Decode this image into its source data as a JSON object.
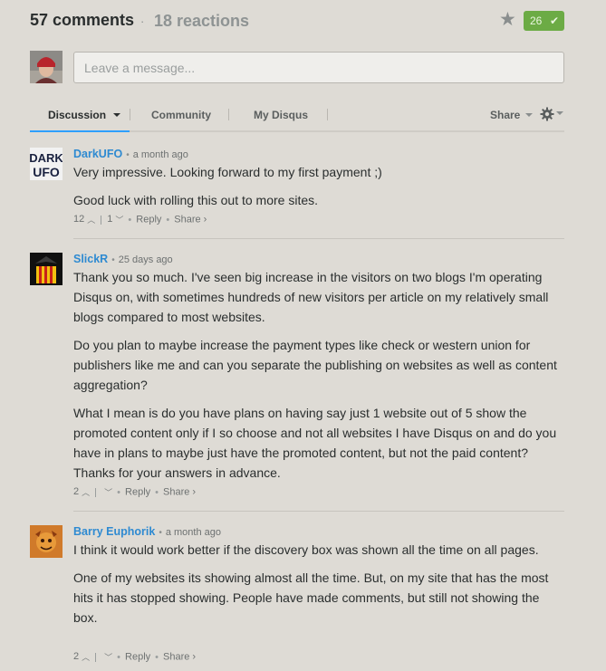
{
  "header": {
    "comments_count": "57 comments",
    "separator": "·",
    "reactions_count": "18 reactions",
    "favorite_count": "26",
    "accent_color": "#6cab45",
    "link_color": "#2e8ad1"
  },
  "composer": {
    "placeholder": "Leave a message..."
  },
  "nav": {
    "tabs": [
      {
        "label": "Discussion"
      },
      {
        "label": "Community"
      },
      {
        "label": "My Disqus"
      }
    ],
    "share_label": "Share"
  },
  "posts": [
    {
      "author": "DarkUFO",
      "time": "a month ago",
      "paragraphs": [
        "Very impressive. Looking forward to my first payment ;)",
        "Good luck with rolling this out to more sites."
      ],
      "upvotes": "12",
      "downvotes": "1",
      "reply_label": "Reply",
      "share_label": "Share ›"
    },
    {
      "author": "SlickR",
      "time": "25 days ago",
      "paragraphs": [
        "Thank you so much. I've seen big increase in the visitors on two blogs I'm operating Disqus on, with sometimes hundreds of new visitors per article on my relatively small blogs compared to most websites.",
        "Do you plan to maybe increase the payment types like check or western union for publishers like me and can you separate the publishing on websites as well as content aggregation?",
        "What I mean is do you have plans on having say just 1 website out of 5 show the promoted content only if I so choose and not all websites I have Disqus on and do you have in plans to maybe just have the promoted content, but not the paid content? Thanks for your answers in advance."
      ],
      "upvotes": "2",
      "downvotes": "",
      "reply_label": "Reply",
      "share_label": "Share ›"
    },
    {
      "author": "Barry Euphorik",
      "time": "a month ago",
      "paragraphs": [
        "I think it would work better if the discovery box was shown all the time on all pages.",
        "One of my websites its showing almost all the time. But, on my site that has the most hits it has stopped showing. People have made comments, but still not showing the box."
      ],
      "upvotes": "2",
      "downvotes": "",
      "reply_label": "Reply",
      "share_label": "Share ›"
    }
  ]
}
